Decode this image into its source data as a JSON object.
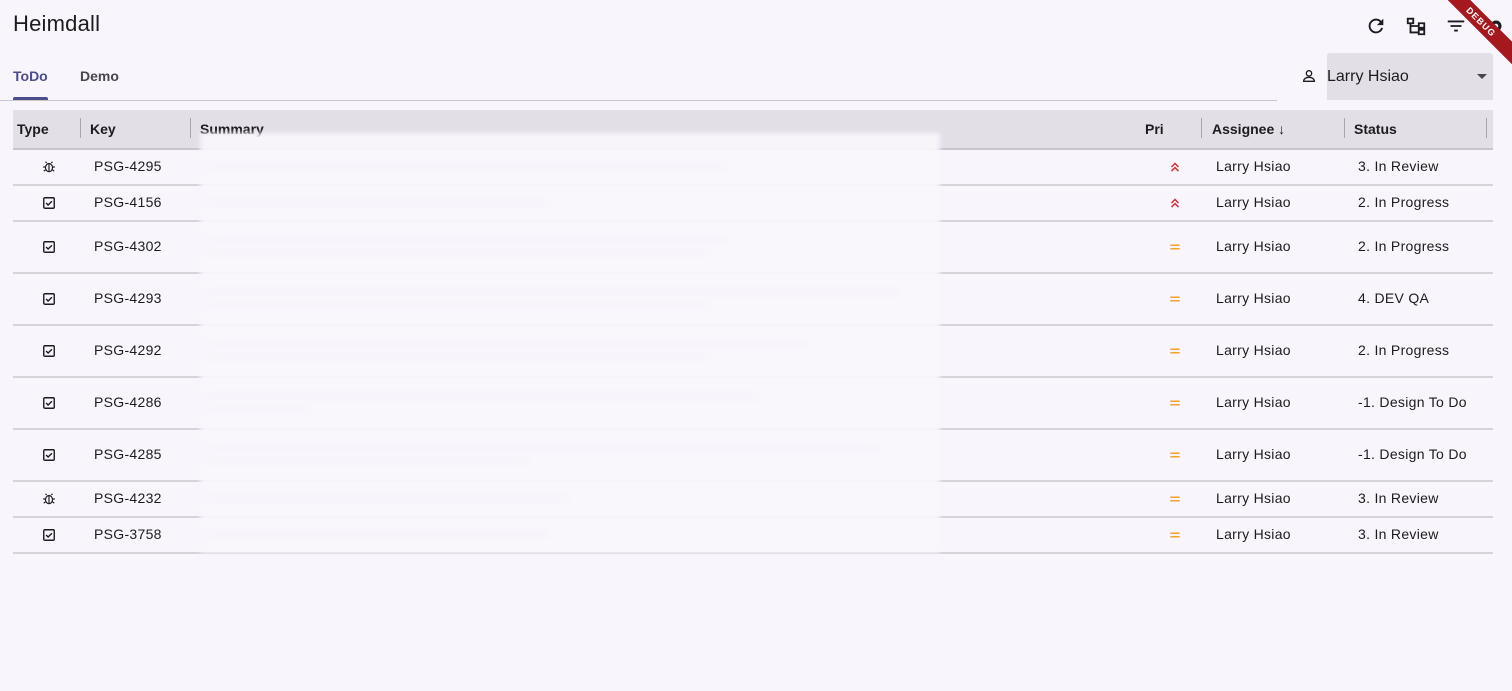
{
  "app": {
    "title": "Heimdall",
    "debug_label": "DEBUG"
  },
  "toolbar": {
    "icons": [
      "refresh-icon",
      "hierarchy-icon",
      "filter-icon",
      "settings-icon"
    ]
  },
  "tabs": [
    {
      "label": "ToDo",
      "active": true
    },
    {
      "label": "Demo",
      "active": false
    }
  ],
  "user_select": {
    "value": "Larry Hsiao"
  },
  "table": {
    "headers": {
      "type": "Type",
      "key": "Key",
      "summary": "Summary",
      "pri": "Pri",
      "assignee": "Assignee ↓",
      "status": "Status"
    },
    "rows": [
      {
        "type": "bug",
        "key": "PSG-4295",
        "pri": "highest",
        "assignee": "Larry Hsiao",
        "status": "3. In Review"
      },
      {
        "type": "task",
        "key": "PSG-4156",
        "pri": "highest",
        "assignee": "Larry Hsiao",
        "status": "2. In Progress"
      },
      {
        "type": "task",
        "key": "PSG-4302",
        "pri": "medium",
        "assignee": "Larry Hsiao",
        "status": "2. In Progress"
      },
      {
        "type": "task",
        "key": "PSG-4293",
        "pri": "medium",
        "assignee": "Larry Hsiao",
        "status": "4. DEV QA"
      },
      {
        "type": "task",
        "key": "PSG-4292",
        "pri": "medium",
        "assignee": "Larry Hsiao",
        "status": "2. In Progress"
      },
      {
        "type": "task",
        "key": "PSG-4286",
        "pri": "medium",
        "assignee": "Larry Hsiao",
        "status": "-1. Design To Do"
      },
      {
        "type": "task",
        "key": "PSG-4285",
        "pri": "medium",
        "assignee": "Larry Hsiao",
        "status": "-1. Design To Do"
      },
      {
        "type": "bug",
        "key": "PSG-4232",
        "pri": "medium",
        "assignee": "Larry Hsiao",
        "status": "3. In Review"
      },
      {
        "type": "task",
        "key": "PSG-3758",
        "pri": "medium",
        "assignee": "Larry Hsiao",
        "status": "3. In Review"
      }
    ]
  },
  "colors": {
    "accent": "#4b4d8c",
    "pri_high": "#d1343a",
    "pri_medium": "#f2a12f"
  }
}
